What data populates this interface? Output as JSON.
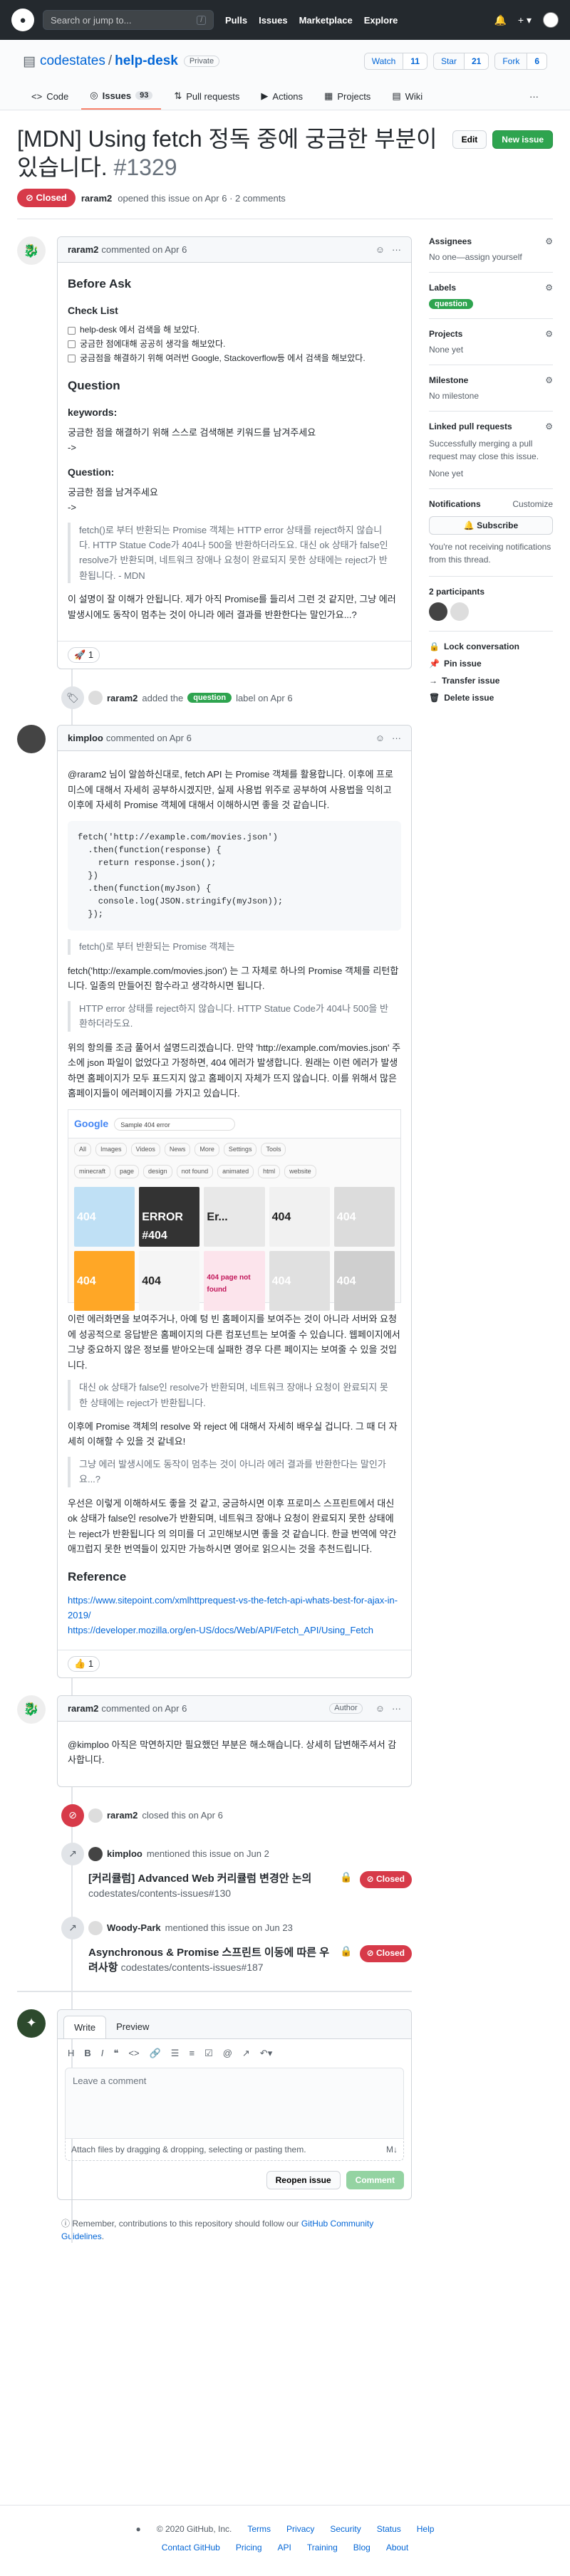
{
  "topbar": {
    "search_placeholder": "Search or jump to...",
    "search_hint": "/",
    "nav": [
      "Pulls",
      "Issues",
      "Marketplace",
      "Explore"
    ]
  },
  "repo": {
    "owner": "codestates",
    "name": "help-desk",
    "visibility": "Private",
    "watch_label": "Watch",
    "watch_count": "11",
    "star_label": "Star",
    "star_count": "21",
    "fork_label": "Fork",
    "fork_count": "6",
    "tabs": [
      {
        "label": "Code"
      },
      {
        "label": "Issues",
        "count": "93"
      },
      {
        "label": "Pull requests"
      },
      {
        "label": "Actions"
      },
      {
        "label": "Projects"
      },
      {
        "label": "Wiki"
      }
    ]
  },
  "issue": {
    "title": "[MDN] Using fetch 정독 중에 궁금한 부분이 있습니다.",
    "number": "#1329",
    "edit_label": "Edit",
    "new_issue_label": "New issue",
    "state": "Closed",
    "author": "raram2",
    "meta": "opened this issue on Apr 6 · 2 comments"
  },
  "comment1": {
    "author": "raram2",
    "time": "commented on Apr 6",
    "h_before": "Before Ask",
    "h_checklist": "Check List",
    "checks": [
      "help-desk 에서 검색을 해 보았다.",
      "궁금한 점에대해 공공히 생각을 해보았다.",
      "궁금점을 해결하기 위해 여러번 Google, Stackoverflow등 에서 검색을 해보았다."
    ],
    "h_question": "Question",
    "kw_label": "keywords:",
    "kw_text": "궁금한 점을 해결하기 위해 스스로 검색해본 키워드를 남겨주세요",
    "arrow": "->",
    "q_label": "Question:",
    "q_text": "궁금한 점을 남겨주세요",
    "quote": "fetch()로 부터 반환되는 Promise 객체는 HTTP error 상태를 reject하지 않습니다. HTTP Statue Code가 404나 500을 반환하더라도요. 대신 ok 상태가 false인 resolve가 반환되며, 네트워크 장애나 요청이 완료되지 못한 상태에는 reject가 반환됩니다. - MDN",
    "text": "이 설명이 잘 이해가 안됩니다. 제가 아직 Promise를 들리서 그런 것 같지만, 그냥 에러 발생시에도 동작이 멈추는 것이 아니라 에러 결과를 반환한다는 말인가요...?",
    "reaction": "🚀",
    "reaction_count": "1"
  },
  "event_label": {
    "actor": "raram2",
    "action": "added the",
    "label": "question",
    "suffix": "label on Apr 6"
  },
  "comment2": {
    "author": "kimploo",
    "time": "commented on Apr 6",
    "p1": "@raram2 님이 알씀하신대로, fetch API 는 Promise 객체를 활용합니다. 이후에 프로미스에 대해서 자세히 공부하시겠지만, 실제 사용법 위주로 공부하여 사용법을 익히고 이후에 자세히 Promise 객체에 대해서 이해하시면 좋을 것 같습니다.",
    "code": [
      "fetch('http://example.com/movies.json')",
      "  .then(function(response) {",
      "    return response.json();",
      "  })",
      "  .then(function(myJson) {",
      "    console.log(JSON.stringify(myJson));",
      "  });"
    ],
    "q1": "fetch()로 부터 반환되는 Promise 객체는",
    "p2": "fetch('http://example.com/movies.json') 는 그 자체로 하나의 Promise 객체를 리턴합니다. 일종의 만들어진 함수라고 생각하시면 됩니다.",
    "q2": "HTTP error 상태를 reject하지 않습니다. HTTP Statue Code가 404나 500을 반환하더라도요.",
    "p3": "위의 항의를 조금 풀어서 설명드리겠습니다. 만약 'http://example.com/movies.json' 주소에 json 파일이 없었다고 가정하면, 404 에러가 발생합니다. 원래는 이런 에러가 발생하면 홈페이지가 모두 표드지지 않고 홈페이지 자체가 뜨지 않습니다. 이를 위해서 많은 홈페이지들이 에러페이지를 가지고 있습니다.",
    "shot_logo": "Google",
    "shot_query": "Sample 404 error",
    "shot_filters": [
      "All",
      "Images",
      "Videos",
      "News",
      "More",
      "Settings",
      "Tools"
    ],
    "shot_chips": [
      "minecraft",
      "page",
      "design",
      "not found",
      "animated",
      "html",
      "website"
    ],
    "tiles": [
      "404",
      "ERROR #404",
      "Er...",
      "404",
      "404",
      "404",
      "404",
      "404 page not found",
      "404",
      "404"
    ],
    "p4": "이런 에러화면을 보여주거나, 아예 텅 빈 홈페이지를 보여주는 것이 아니라 서버와 요청에 성공적으로 응답받은 홈페이지의 다른 컴포넌트는 보여줄 수 있습니다. 웹페이지에서 그냥 중요하지 않은 정보를 받아오는데 실패한 경우 다른 페이지는 보여줄 수 있을 것입니다.",
    "q3": "대신 ok 상태가 false인 resolve가 반환되며, 네트워크 장애나 요청이 완료되지 못한 상태에는 reject가 반환됩니다.",
    "p5": "이후에 Promise 객체의 resolve 와 reject 에 대해서 자세히 배우실 겁니다. 그 때 더 자세히 이해할 수 있을 것 같네요!",
    "q4": "그냥 에러 발생시에도 동작이 멈추는 것이 아니라 에러 결과를 반환한다는 말인가요...?",
    "p6": "우선은 이렇게 이해하셔도 좋을 것 같고, 궁금하시면 이후 프로미스 스프린트에서 대신 ok 상태가 false인 resolve가 반환되며, 네트워크 장애나 요청이 완료되지 못한 상태에는 reject가 반환됩니다 의 의미를 더 고민해보시면 좋을 것 같습니다. 한글 번역에 약간 애끄럽지 못한 번역들이 있지만 가능하시면 영어로 읽으시는 것을 추천드립니다.",
    "h_ref": "Reference",
    "links": [
      "https://www.sitepoint.com/xmlhttprequest-vs-the-fetch-api-whats-best-for-ajax-in-2019/",
      "https://developer.mozilla.org/en-US/docs/Web/API/Fetch_API/Using_Fetch"
    ],
    "reaction": "👍",
    "reaction_count": "1"
  },
  "comment3": {
    "author": "raram2",
    "time": "commented on Apr 6",
    "tag": "Author",
    "text": "@kimploo 아직은 막연하지만 필요했던 부분은 해소해습니다. 상세히 답변해주셔서 감사합니다."
  },
  "event_closed": {
    "actor": "raram2",
    "text": "closed this on Apr 6"
  },
  "mentions": [
    {
      "actor": "kimploo",
      "text": "mentioned this issue on Jun 2",
      "title": "[커리큘럼] Advanced Web 커리큘럼 변경안 논의",
      "ref": "codestates/contents-issues#130",
      "state": "Closed"
    },
    {
      "actor": "Woody-Park",
      "text": "mentioned this issue on Jun 23",
      "title": "Asynchronous & Promise 스프린트 이동에 따른 우려사항",
      "ref": "codestates/contents-issues#187",
      "state": "Closed"
    }
  ],
  "editor": {
    "tab_write": "Write",
    "tab_preview": "Preview",
    "placeholder": "Leave a comment",
    "attach": "Attach files by dragging & dropping, selecting or pasting them.",
    "reopen": "Reopen issue",
    "comment": "Comment",
    "note_pre": "Remember, contributions to this repository should follow our",
    "note_link": "GitHub Community Guidelines",
    "note_post": "."
  },
  "sidebar": {
    "assignees": "Assignees",
    "assignees_val": "No one—assign yourself",
    "labels": "Labels",
    "label_val": "question",
    "projects": "Projects",
    "projects_val": "None yet",
    "milestone": "Milestone",
    "milestone_val": "No milestone",
    "linked": "Linked pull requests",
    "linked_val": "Successfully merging a pull request may close this issue.",
    "linked_none": "None yet",
    "notifications": "Notifications",
    "customize": "Customize",
    "subscribe": "Subscribe",
    "notif_text": "You're not receiving notifications from this thread.",
    "participants": "2 participants",
    "actions": [
      "Lock conversation",
      "Pin issue",
      "Transfer issue",
      "Delete issue"
    ]
  },
  "footer": {
    "copyright": "© 2020 GitHub, Inc.",
    "row1": [
      "Terms",
      "Privacy",
      "Security",
      "Status",
      "Help"
    ],
    "row2": [
      "Contact GitHub",
      "Pricing",
      "API",
      "Training",
      "Blog",
      "About"
    ]
  },
  "colors": {
    "accent": "#0366d6",
    "closed": "#d73a49",
    "green": "#2ea44f",
    "header": "#24292e"
  }
}
